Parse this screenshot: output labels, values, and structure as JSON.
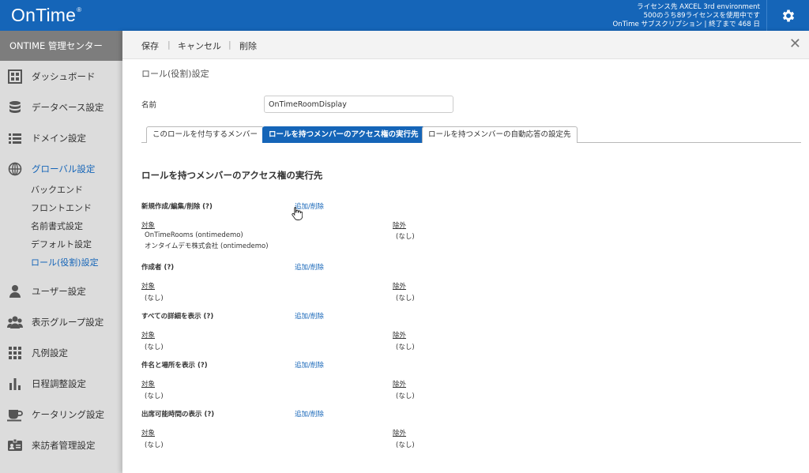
{
  "header": {
    "logo_text": "OnTime",
    "logo_mark": "®",
    "license_line1": "ライセンス先 AXCEL 3rd environment",
    "license_line2": "500のうち89ライセンスを使用中です",
    "license_line3": "OnTime サブスクリプション | 終了まで 468 日",
    "brand_color": "#1565b8"
  },
  "sidebar": {
    "title": "ONTIME 管理センター",
    "items": [
      {
        "label": "ダッシュボード",
        "icon": "dashboard-icon"
      },
      {
        "label": "データベース設定",
        "icon": "database-icon"
      },
      {
        "label": "ドメイン設定",
        "icon": "domain-list-icon"
      },
      {
        "label": "グローバル設定",
        "icon": "globe-icon"
      },
      {
        "label": "ユーザー設定",
        "icon": "user-icon"
      },
      {
        "label": "表示グループ設定",
        "icon": "group-icon"
      },
      {
        "label": "凡例設定",
        "icon": "grid-icon"
      },
      {
        "label": "日程調整設定",
        "icon": "bar-chart-icon"
      },
      {
        "label": "ケータリング設定",
        "icon": "cup-icon"
      },
      {
        "label": "来訪者管理設定",
        "icon": "id-card-icon"
      }
    ],
    "sub_items": [
      "バックエンド",
      "フロントエンド",
      "名前書式設定",
      "デフォルト設定",
      "ロール(役割)設定"
    ]
  },
  "toolbar": {
    "save": "保存",
    "cancel": "キャンセル",
    "delete": "削除",
    "separator": "|",
    "close": "✕"
  },
  "page": {
    "title": "ロール(役割)設定",
    "name_label": "名前",
    "name_value": "OnTimeRoomDisplay",
    "tabs": [
      "このロールを付与するメンバー",
      "ロールを持つメンバーのアクセス権の実行先",
      "ロールを持つメンバーの自動応答の設定先"
    ],
    "section_title": "ロールを持つメンバーのアクセス権の実行先",
    "add_remove": "追加/削除",
    "target_header": "対象",
    "exclude_header": "除外",
    "none": "(なし)",
    "permissions": [
      {
        "label": "新規作成/編集/削除 (?)",
        "targets": [
          "OnTimeRooms (ontimedemo)",
          "オンタイムデモ株式会社 (ontimedemo)"
        ],
        "exclusions": [
          "(なし)"
        ]
      },
      {
        "label": "作成者 (?)",
        "targets": [
          "(なし)"
        ],
        "exclusions": [
          "(なし)"
        ]
      },
      {
        "label": "すべての詳細を表示 (?)",
        "targets": [
          "(なし)"
        ],
        "exclusions": [
          "(なし)"
        ]
      },
      {
        "label": "件名と場所を表示 (?)",
        "targets": [
          "(なし)"
        ],
        "exclusions": [
          "(なし)"
        ]
      },
      {
        "label": "出席可能時間の表示 (?)",
        "targets": [
          "(なし)"
        ],
        "exclusions": [
          "(なし)"
        ]
      }
    ]
  }
}
